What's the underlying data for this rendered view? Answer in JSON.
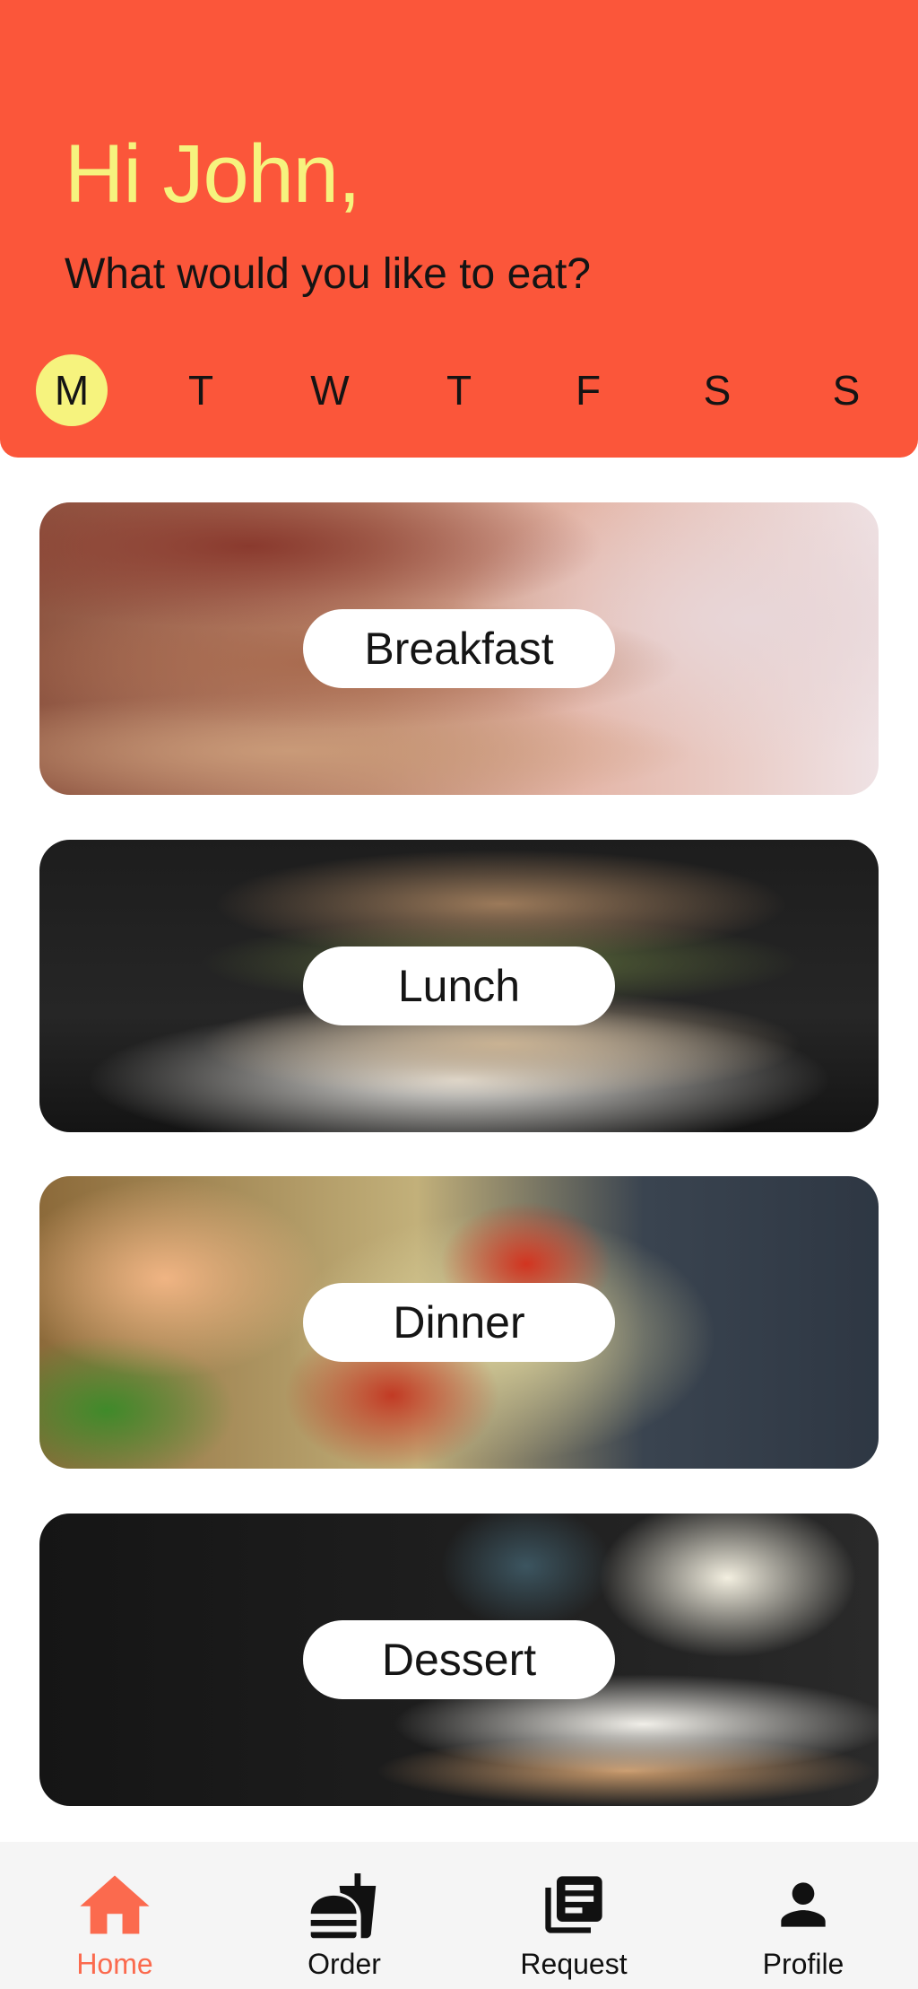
{
  "header": {
    "greeting": "Hi John,",
    "question": "What would you like to eat?"
  },
  "days": [
    {
      "label": "M",
      "active": true
    },
    {
      "label": "T",
      "active": false
    },
    {
      "label": "W",
      "active": false
    },
    {
      "label": "T",
      "active": false
    },
    {
      "label": "F",
      "active": false
    },
    {
      "label": "S",
      "active": false
    },
    {
      "label": "S",
      "active": false
    }
  ],
  "meals": [
    {
      "label": "Breakfast",
      "image": "pancakes"
    },
    {
      "label": "Lunch",
      "image": "sandwich"
    },
    {
      "label": "Dinner",
      "image": "shrimp-pasta"
    },
    {
      "label": "Dessert",
      "image": "cake-with-flowers"
    }
  ],
  "nav": [
    {
      "label": "Home",
      "icon": "home-icon",
      "active": true
    },
    {
      "label": "Order",
      "icon": "fastfood-icon",
      "active": false
    },
    {
      "label": "Request",
      "icon": "library-books-icon",
      "active": false
    },
    {
      "label": "Profile",
      "icon": "person-icon",
      "active": false
    }
  ],
  "colors": {
    "header_bg": "#FB563A",
    "greeting": "#F6F37E",
    "active_day": "#F6F37E",
    "nav_active": "#FB6A4E",
    "nav_bg": "#F5F5F5"
  }
}
